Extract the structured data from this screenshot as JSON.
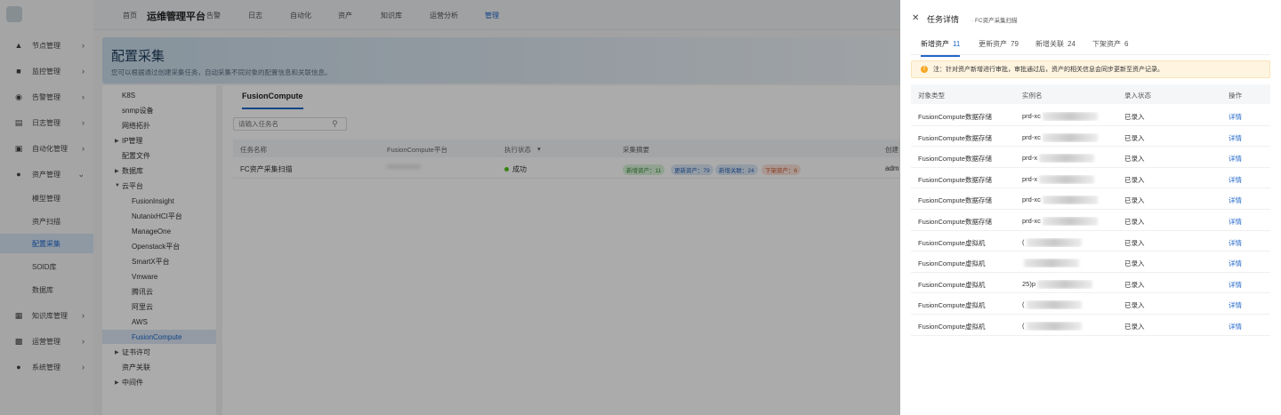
{
  "app": {
    "title": "运维管理平台"
  },
  "topnav": [
    "首页",
    "监控",
    "告警",
    "日志",
    "自动化",
    "资产",
    "知识库",
    "运营分析",
    "管理"
  ],
  "sidebar": {
    "items": [
      {
        "label": "节点管理",
        "icon": "nodes-icon"
      },
      {
        "label": "监控管理",
        "icon": "monitor-icon"
      },
      {
        "label": "告警管理",
        "icon": "alarm-icon"
      },
      {
        "label": "日志管理",
        "icon": "log-icon"
      },
      {
        "label": "自动化管理",
        "icon": "automation-icon"
      },
      {
        "label": "资产管理",
        "icon": "asset-icon"
      },
      {
        "label": "知识库管理",
        "icon": "knowledge-icon"
      },
      {
        "label": "运营管理",
        "icon": "operation-icon"
      },
      {
        "label": "系统管理",
        "icon": "system-icon"
      }
    ],
    "sub_items": [
      "模型管理",
      "资产扫描",
      "配置采集",
      "SOID库",
      "数据库"
    ]
  },
  "banner": {
    "title": "配置采集",
    "desc": "您可以根据通过创建采集任务，自动采集不同对象的配置信息和关联信息。"
  },
  "tree": [
    "K8S",
    "snmp设备",
    "网络拓扑",
    "IP管理",
    "配置文件",
    "数据库",
    "云平台",
    "FusionInsight",
    "NutanixHCI平台",
    "ManageOne",
    "Openstack平台",
    "SmartX平台",
    "Vmware",
    "腾讯云",
    "阿里云",
    "AWS",
    "FusionCompute",
    "证书许可",
    "资产关联",
    "中间件"
  ],
  "content": {
    "tab": "FusionCompute",
    "search_placeholder": "请输入任务名",
    "columns": [
      "任务名称",
      "FusionCompute平台",
      "执行状态",
      "采集摘要",
      "创建"
    ],
    "row": {
      "name": "FC资产采集扫描",
      "platform": "************",
      "status": "成功",
      "tags": [
        "新增资产：11",
        "更新资产：79",
        "新增关联：24",
        "下架资产：6"
      ],
      "creator": "adm"
    }
  },
  "drawer": {
    "title": "任务详情",
    "subtitle": "· FC资产采集扫描",
    "tabs": [
      {
        "label": "新增资产",
        "count": "11"
      },
      {
        "label": "更新资产",
        "count": "79"
      },
      {
        "label": "新增关联",
        "count": "24"
      },
      {
        "label": "下架资产",
        "count": "6"
      }
    ],
    "notice": "注：针对资产新增进行审批，审批通过后，资产的相关信息会同步更新至资产记录。",
    "columns": [
      "对象类型",
      "实例名",
      "录入状态",
      "操作"
    ],
    "rows": [
      {
        "type": "FusionCompute数据存储",
        "instance": "prd-xc",
        "status": "已录入",
        "action": "详情"
      },
      {
        "type": "FusionCompute数据存储",
        "instance": "prd-xc",
        "status": "已录入",
        "action": "详情"
      },
      {
        "type": "FusionCompute数据存储",
        "instance": "prd-x",
        "status": "已录入",
        "action": "详情"
      },
      {
        "type": "FusionCompute数据存储",
        "instance": "prd-x",
        "status": "已录入",
        "action": "详情"
      },
      {
        "type": "FusionCompute数据存储",
        "instance": "prd-xc",
        "status": "已录入",
        "action": "详情"
      },
      {
        "type": "FusionCompute数据存储",
        "instance": "prd-xc",
        "status": "已录入",
        "action": "详情"
      },
      {
        "type": "FusionCompute虚拟机",
        "instance": "(",
        "status": "已录入",
        "action": "详情"
      },
      {
        "type": "FusionCompute虚拟机",
        "instance": "",
        "status": "已录入",
        "action": "详情"
      },
      {
        "type": "FusionCompute虚拟机",
        "instance": "25)p",
        "status": "已录入",
        "action": "详情"
      },
      {
        "type": "FusionCompute虚拟机",
        "instance": "(",
        "status": "已录入",
        "action": "详情"
      },
      {
        "type": "FusionCompute虚拟机",
        "instance": "(",
        "status": "已录入",
        "action": "详情"
      }
    ]
  }
}
